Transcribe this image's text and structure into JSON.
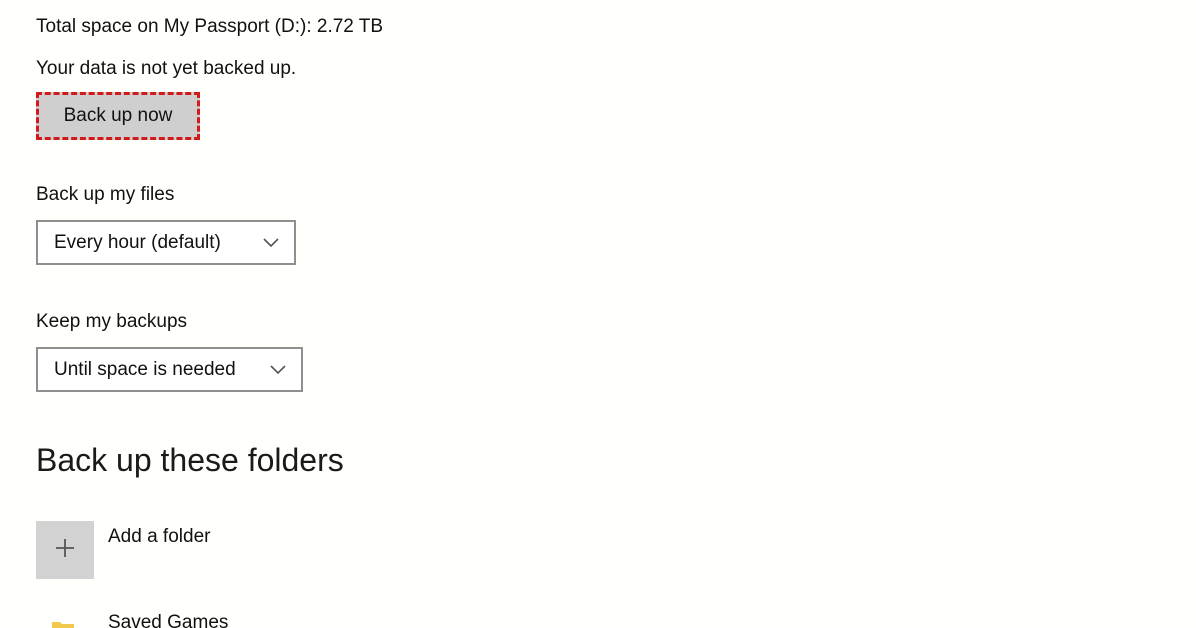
{
  "backup": {
    "total_space_text": "Total space on My Passport (D:): 2.72 TB",
    "status_text": "Your data is not yet backed up.",
    "backup_now_label": "Back up now"
  },
  "frequency": {
    "label": "Back up my files",
    "selected": "Every hour (default)"
  },
  "retention": {
    "label": "Keep my backups",
    "selected": "Until space is needed"
  },
  "folders": {
    "title": "Back up these folders",
    "add_label": "Add a folder",
    "items": [
      {
        "name": "Saved Games",
        "icon": "folder-icon"
      }
    ]
  },
  "colors": {
    "focus_outline": "#d21a1a",
    "button_background": "#cfcfcf",
    "add_tile_background": "#d2d2d2",
    "folder_icon": "#f2c94c"
  }
}
